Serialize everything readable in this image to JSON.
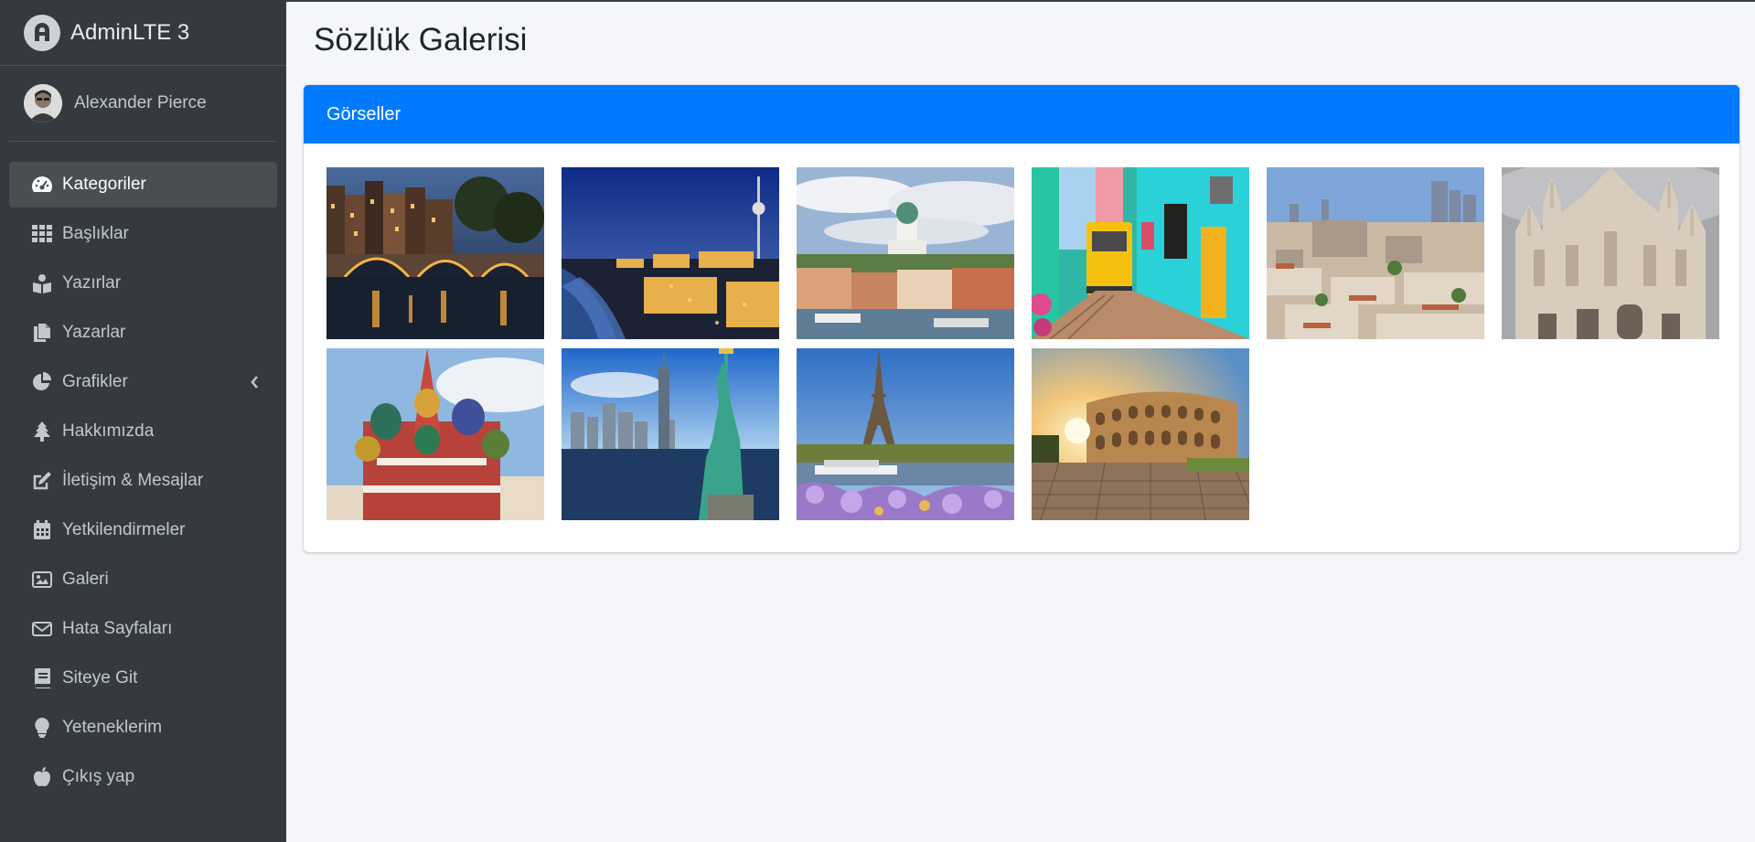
{
  "brand": {
    "name": "AdminLTE 3"
  },
  "user": {
    "name": "Alexander Pierce"
  },
  "nav": [
    {
      "label": "Kategoriler",
      "icon": "tachometer-icon",
      "active": true
    },
    {
      "label": "Başlıklar",
      "icon": "grid-icon"
    },
    {
      "label": "Yazırlar",
      "icon": "book-reader-icon"
    },
    {
      "label": "Yazarlar",
      "icon": "copy-icon"
    },
    {
      "label": "Grafikler",
      "icon": "pie-chart-icon",
      "has_arrow": true
    },
    {
      "label": "Hakkımızda",
      "icon": "tree-icon"
    },
    {
      "label": "İletişim & Mesajlar",
      "icon": "edit-icon"
    },
    {
      "label": "Yetkilendirmeler",
      "icon": "calendar-icon"
    },
    {
      "label": "Galeri",
      "icon": "image-icon"
    },
    {
      "label": "Hata Sayfaları",
      "icon": "envelope-icon"
    },
    {
      "label": "Siteye Git",
      "icon": "book-icon"
    },
    {
      "label": "Yeteneklerim",
      "icon": "lightbulb-icon"
    },
    {
      "label": "Çıkış yap",
      "icon": "apple-icon"
    }
  ],
  "page": {
    "title": "Sözlük Galerisi"
  },
  "card": {
    "header": "Görseller"
  },
  "colors": {
    "sidebar": "#343a40",
    "accent": "#007bff",
    "background": "#f4f6f9",
    "text_muted": "#c2c7d0"
  },
  "gallery": [
    {
      "name": "amsterdam-canal-night"
    },
    {
      "name": "berlin-tv-tower-night"
    },
    {
      "name": "helsinki-cathedral"
    },
    {
      "name": "lisbon-yellow-tram"
    },
    {
      "name": "madrid-skyline"
    },
    {
      "name": "milan-cathedral"
    },
    {
      "name": "moscow-saint-basil"
    },
    {
      "name": "new-york-statue-of-liberty"
    },
    {
      "name": "paris-eiffel-tower"
    },
    {
      "name": "rome-colosseum"
    }
  ]
}
